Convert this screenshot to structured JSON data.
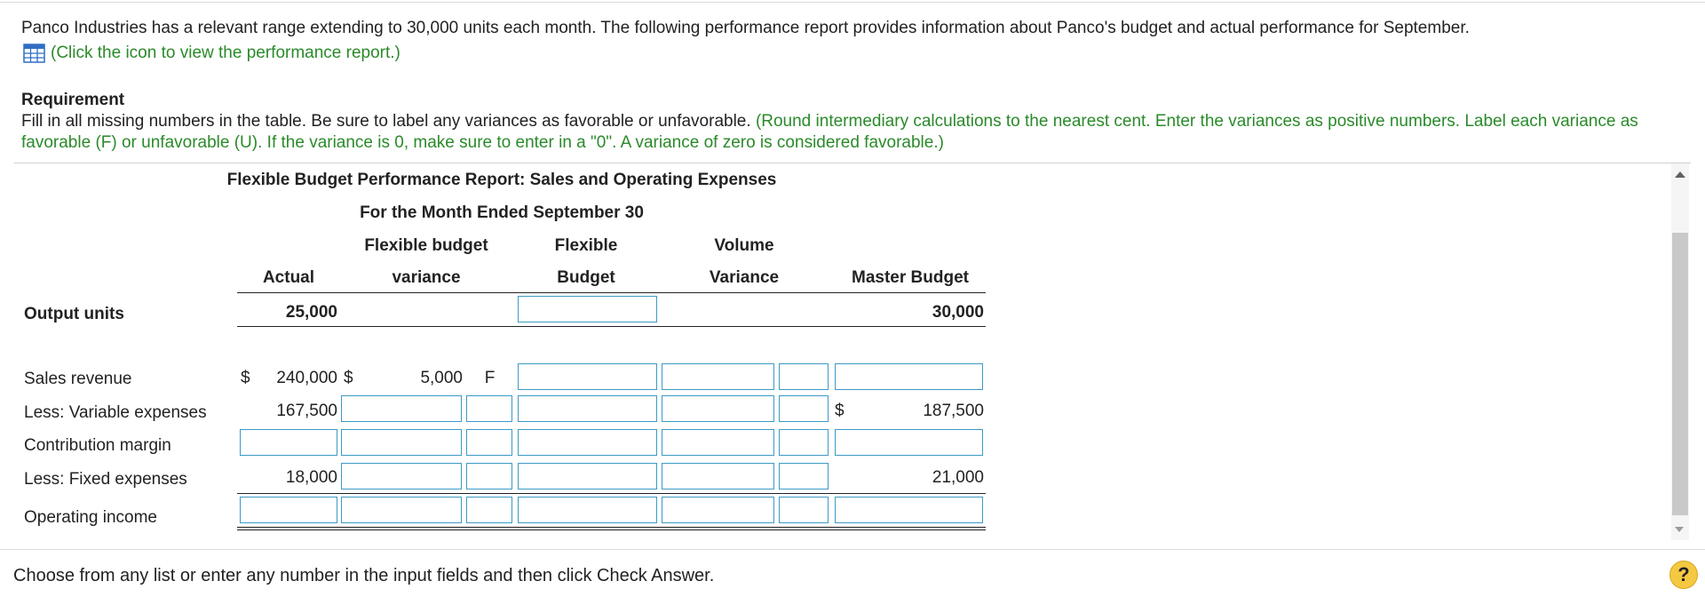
{
  "intro": {
    "text": "Panco Industries has a relevant range extending to 30,000 units each month. The following performance report provides information about Panco's budget and actual performance for September.",
    "link": "(Click the icon to view the performance report.)"
  },
  "requirement": {
    "title": "Requirement",
    "text": "Fill in all missing numbers in the table. Be sure to label any variances as favorable or unfavorable.",
    "instructions": "(Round intermediary calculations to the nearest cent. Enter the variances as positive numbers. Label each variance as favorable (F) or unfavorable (U). If the variance is 0, make sure to enter in a \"0\". A variance of zero is considered favorable.)"
  },
  "report": {
    "title": "Flexible Budget Performance Report: Sales and Operating Expenses",
    "subtitle": "For the Month Ended September 30",
    "headers": {
      "actual": "Actual",
      "fbv_1": "Flexible budget",
      "fbv_2": "variance",
      "fb_1": "Flexible",
      "fb_2": "Budget",
      "vv_1": "Volume",
      "vv_2": "Variance",
      "master": "Master Budget"
    },
    "output_units": {
      "label": "Output units",
      "actual": "25,000",
      "master": "30,000"
    },
    "rows": [
      {
        "label": "Sales revenue",
        "actual_sign": "$",
        "actual": "240,000",
        "fbv_sign": "$",
        "fbv": "5,000",
        "fbv_label": "F",
        "master_sign": "",
        "master": ""
      },
      {
        "label": "Less: Variable expenses",
        "actual_sign": "",
        "actual": "167,500",
        "fbv_sign": "",
        "fbv": "",
        "fbv_label": "",
        "master_sign": "$",
        "master": "187,500"
      },
      {
        "label": "Contribution margin",
        "actual_sign": "",
        "actual": "",
        "fbv_sign": "",
        "fbv": "",
        "fbv_label": "",
        "master_sign": "",
        "master": ""
      },
      {
        "label": "Less: Fixed expenses",
        "actual_sign": "",
        "actual": "18,000",
        "fbv_sign": "",
        "fbv": "",
        "fbv_label": "",
        "master_sign": "",
        "master": "21,000"
      },
      {
        "label": "Operating income",
        "actual_sign": "",
        "actual": "",
        "fbv_sign": "",
        "fbv": "",
        "fbv_label": "",
        "master_sign": "",
        "master": ""
      }
    ]
  },
  "footer": {
    "text": "Choose from any list or enter any number in the input fields and then click Check Answer.",
    "help": "?"
  },
  "icons": {
    "table": "table-grid-icon",
    "help": "help-icon",
    "scroll_up": "scroll-up-icon",
    "scroll_down": "scroll-down-icon"
  },
  "colors": {
    "link_green": "#2a8a2a",
    "input_border": "#3c9ac6",
    "help_yellow": "#f5c842"
  }
}
